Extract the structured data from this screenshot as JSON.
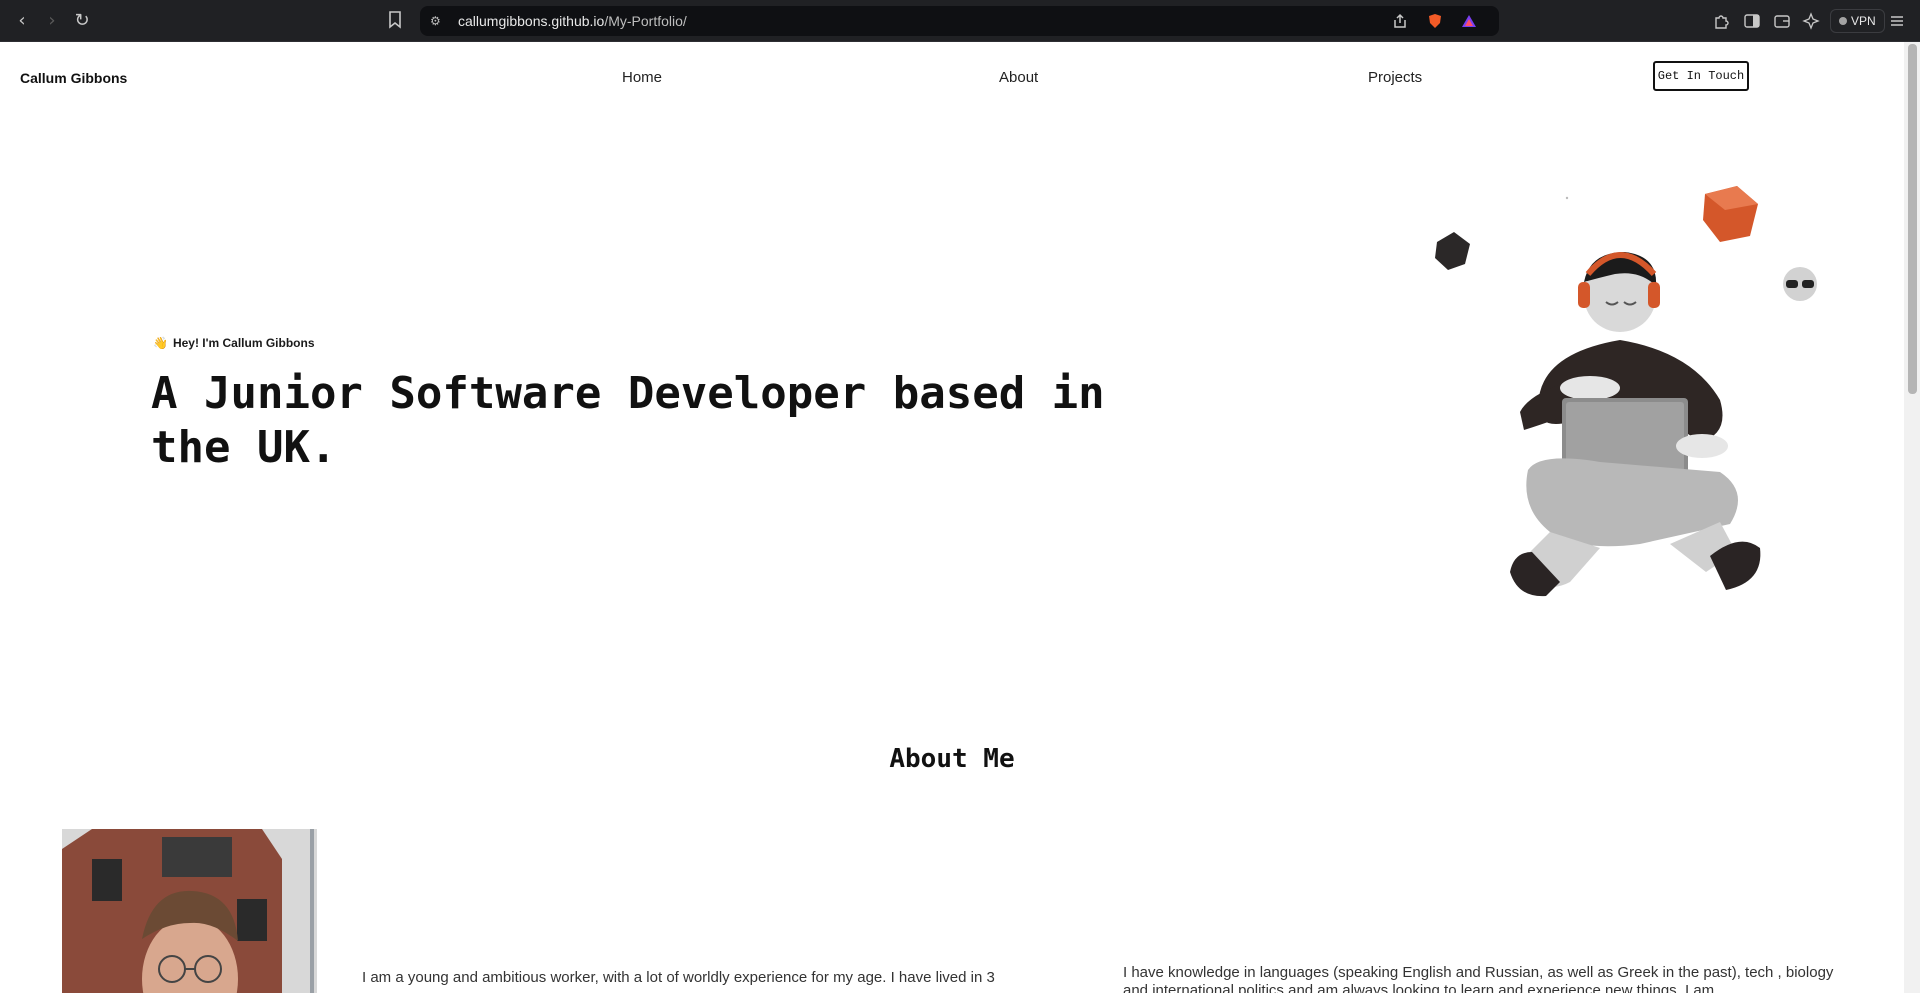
{
  "browser": {
    "url_host": "callumgibbons.github.io",
    "url_path": "/My-Portfolio/",
    "vpn_label": "VPN",
    "icons": [
      "back-icon",
      "forward-icon",
      "reload-icon",
      "bookmark-icon",
      "site-settings-icon",
      "share-icon",
      "brave-shields-icon",
      "brave-rewards-icon",
      "extensions-icon",
      "sidebar-icon",
      "wallet-icon",
      "leo-ai-icon",
      "menu-icon"
    ]
  },
  "site": {
    "brand": "Callum Gibbons",
    "nav": {
      "home": "Home",
      "about": "About",
      "projects": "Projects",
      "cta": "Get In Touch"
    }
  },
  "hero": {
    "greeting_emoji": "👋",
    "greeting": "Hey! I'm Callum Gibbons",
    "headline": "A Junior Software Developer based in the UK."
  },
  "about": {
    "title": "About Me",
    "paragraph_left": "I am a young and ambitious worker, with a lot of worldly experience for my age. I have lived in 3",
    "paragraph_right": "I have knowledge in languages (speaking English and Russian, as well as Greek in the past), tech , biology and international politics and am always looking to learn and experience new things. I am"
  },
  "colors": {
    "accent_orange": "#e0622f",
    "chrome_bg": "#202124",
    "text_dark": "#111111"
  }
}
